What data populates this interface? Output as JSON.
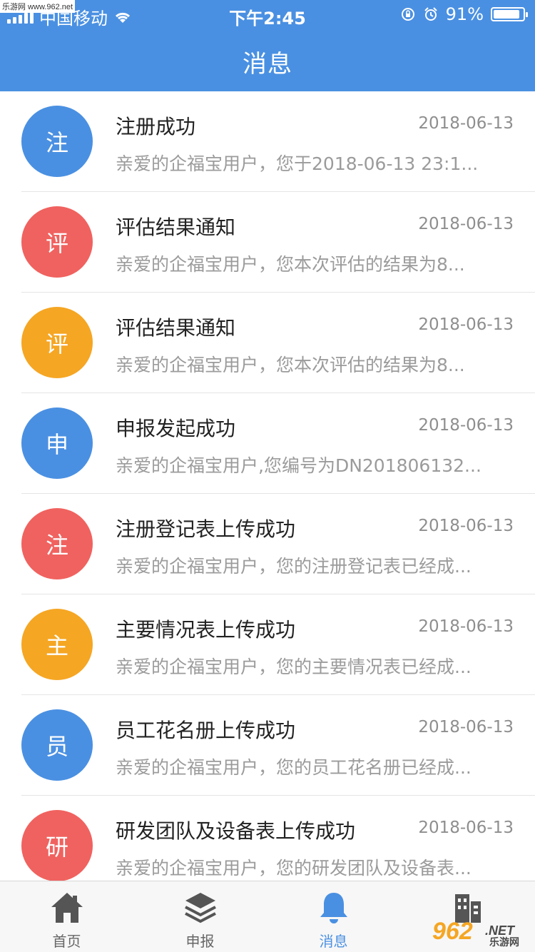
{
  "status_bar": {
    "carrier": "中国移动",
    "time": "下午2:45",
    "battery_percent": "91%",
    "battery_level": 0.91
  },
  "watermark_top_left": "乐游网 www.962.net",
  "header": {
    "title": "消息"
  },
  "messages": [
    {
      "avatar": "注",
      "color": "#4a90e2",
      "title": "注册成功",
      "date": "2018-06-13",
      "preview": "亲爱的企福宝用户，您于2018-06-13 23:1..."
    },
    {
      "avatar": "评",
      "color": "#f0625f",
      "title": "评估结果通知",
      "date": "2018-06-13",
      "preview": "亲爱的企福宝用户，您本次评估的结果为8..."
    },
    {
      "avatar": "评",
      "color": "#f5a623",
      "title": "评估结果通知",
      "date": "2018-06-13",
      "preview": "亲爱的企福宝用户，您本次评估的结果为8..."
    },
    {
      "avatar": "申",
      "color": "#4a90e2",
      "title": "申报发起成功",
      "date": "2018-06-13",
      "preview": "亲爱的企福宝用户,您编号为DN201806132..."
    },
    {
      "avatar": "注",
      "color": "#f0625f",
      "title": "注册登记表上传成功",
      "date": "2018-06-13",
      "preview": "亲爱的企福宝用户，您的注册登记表已经成..."
    },
    {
      "avatar": "主",
      "color": "#f5a623",
      "title": "主要情况表上传成功",
      "date": "2018-06-13",
      "preview": "亲爱的企福宝用户，您的主要情况表已经成..."
    },
    {
      "avatar": "员",
      "color": "#4a90e2",
      "title": "员工花名册上传成功",
      "date": "2018-06-13",
      "preview": "亲爱的企福宝用户，您的员工花名册已经成..."
    },
    {
      "avatar": "研",
      "color": "#f0625f",
      "title": "研发团队及设备表上传成功",
      "date": "2018-06-13",
      "preview": "亲爱的企福宝用户，您的研发团队及设备表..."
    }
  ],
  "tabs": [
    {
      "label": "首页",
      "icon": "home-icon"
    },
    {
      "label": "申报",
      "icon": "layers-icon"
    },
    {
      "label": "消息",
      "icon": "bell-icon",
      "active": true
    },
    {
      "label": "",
      "icon": "building-icon"
    }
  ],
  "watermark_bottom_right": {
    "num": "962",
    "net": ".NET",
    "cn": "乐游网"
  },
  "colors": {
    "primary": "#4a90e2",
    "red": "#f0625f",
    "orange": "#f5a623"
  }
}
